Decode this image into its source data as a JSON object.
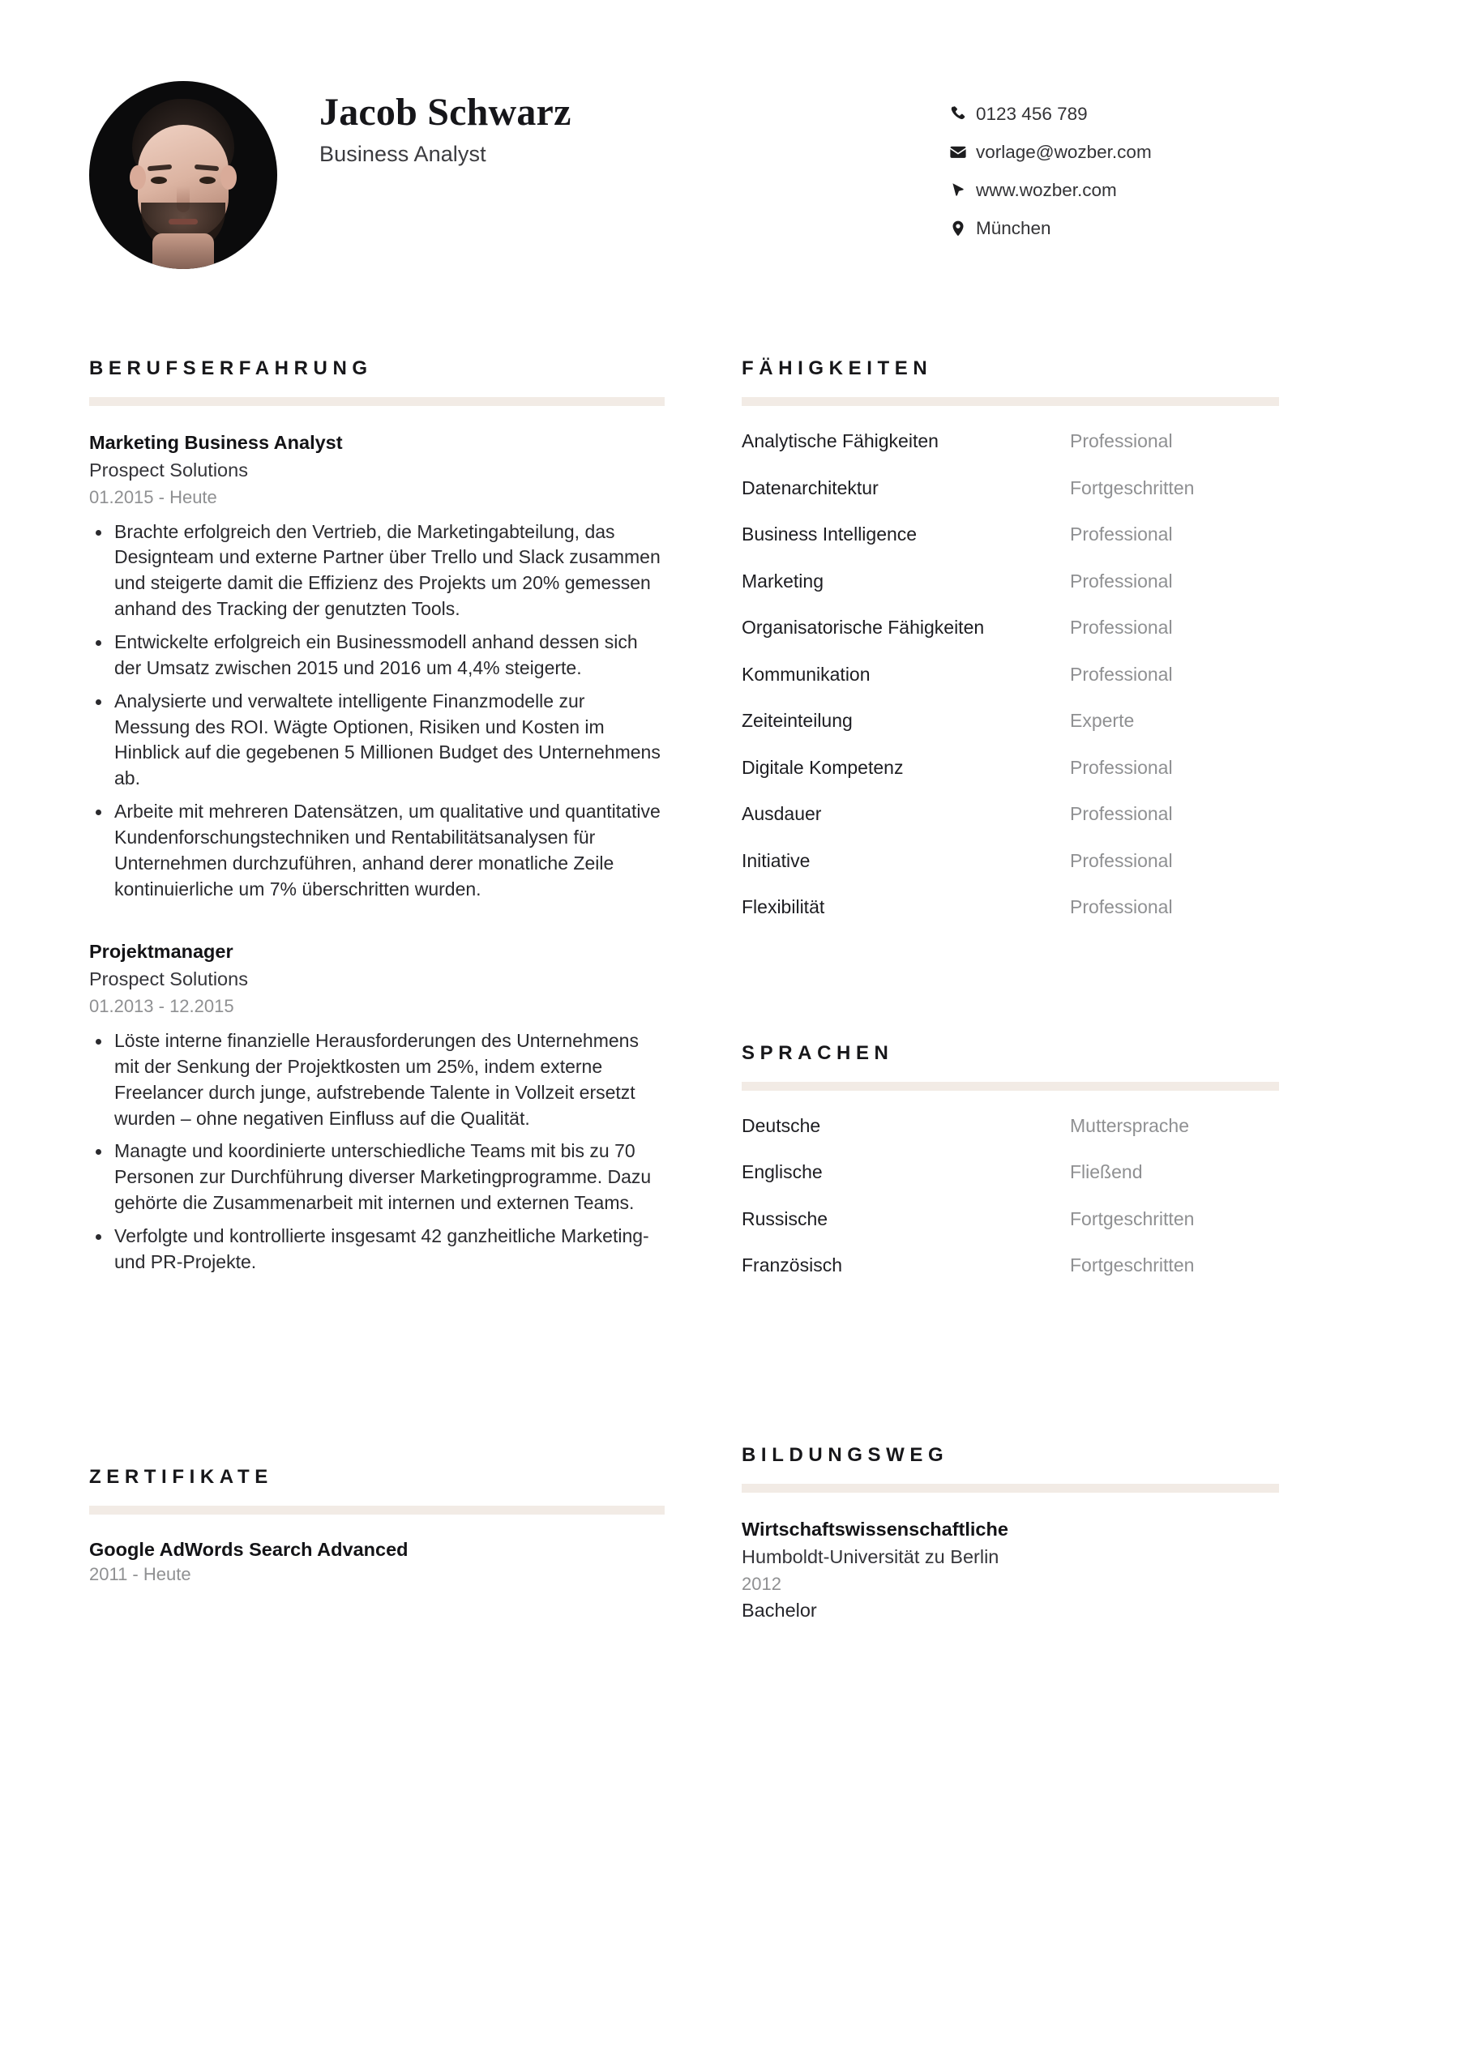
{
  "theme": {
    "accent_rule": "#f2ebe5",
    "text_primary": "#1d1d21",
    "text_muted": "#8f9092",
    "background": "#ffffff"
  },
  "header": {
    "full_name": "Jacob Schwarz",
    "job_title": "Business Analyst",
    "avatar_alt": "portrait-photo",
    "contacts": [
      {
        "icon": "phone-icon",
        "value": "0123 456 789"
      },
      {
        "icon": "envelope-icon",
        "value": "vorlage@wozber.com"
      },
      {
        "icon": "cursor-icon",
        "value": "www.wozber.com"
      },
      {
        "icon": "map-pin-icon",
        "value": "München"
      }
    ]
  },
  "sections": {
    "experience": {
      "title": "BERUFSERFAHRUNG",
      "entries": [
        {
          "role": "Marketing Business Analyst",
          "organization": "Prospect Solutions",
          "dates": "01.2015 - Heute",
          "bullets": [
            "Brachte erfolgreich den Vertrieb, die Marketingabteilung, das Designteam und externe Partner über Trello und Slack zusammen und steigerte damit die Effizienz des Projekts um 20% gemessen anhand des Tracking der genutzten Tools.",
            "Entwickelte erfolgreich ein Businessmodell anhand dessen sich der Umsatz zwischen 2015 und 2016 um 4,4% steigerte.",
            "Analysierte und verwaltete intelligente Finanzmodelle zur Messung des ROI. Wägte Optionen, Risiken und Kosten im Hinblick auf die gegebenen 5 Millionen Budget des Unternehmens ab.",
            "Arbeite mit mehreren Datensätzen, um qualitative und quantitative Kundenforschungstechniken und Rentabilitätsanalysen für Unternehmen durchzuführen, anhand derer monatliche Zeile kontinuierliche um 7% überschritten wurden."
          ]
        },
        {
          "role": "Projektmanager",
          "organization": "Prospect Solutions",
          "dates": "01.2013 - 12.2015",
          "bullets": [
            "Löste interne finanzielle Herausforderungen des Unternehmens mit der Senkung der Projektkosten um 25%, indem externe Freelancer durch junge, aufstrebende Talente in Vollzeit ersetzt wurden – ohne negativen Einfluss auf die Qualität.",
            "Managte und koordinierte unterschiedliche Teams mit bis zu 70 Personen zur Durchführung diverser Marketingprogramme. Dazu gehörte die Zusammenarbeit mit internen und externen Teams.",
            "Verfolgte und kontrollierte insgesamt 42 ganzheitliche Marketing- und PR-Projekte."
          ]
        }
      ]
    },
    "certificates": {
      "title": "ZERTIFIKATE",
      "entries": [
        {
          "name": "Google AdWords Search Advanced",
          "dates": "2011 - Heute"
        }
      ]
    },
    "skills": {
      "title": "FÄHIGKEITEN",
      "items": [
        {
          "name": "Analytische Fähigkeiten",
          "level": "Professional"
        },
        {
          "name": "Datenarchitektur",
          "level": "Fortgeschritten"
        },
        {
          "name": "Business Intelligence",
          "level": "Professional"
        },
        {
          "name": "Marketing",
          "level": "Professional"
        },
        {
          "name": "Organisatorische Fähigkeiten",
          "level": "Professional"
        },
        {
          "name": "Kommunikation",
          "level": "Professional"
        },
        {
          "name": "Zeiteinteilung",
          "level": "Experte"
        },
        {
          "name": "Digitale Kompetenz",
          "level": "Professional"
        },
        {
          "name": "Ausdauer",
          "level": "Professional"
        },
        {
          "name": "Initiative",
          "level": "Professional"
        },
        {
          "name": "Flexibilität",
          "level": "Professional"
        }
      ]
    },
    "languages": {
      "title": "SPRACHEN",
      "items": [
        {
          "name": "Deutsche",
          "level": "Muttersprache"
        },
        {
          "name": "Englische",
          "level": "Fließend"
        },
        {
          "name": "Russische",
          "level": "Fortgeschritten"
        },
        {
          "name": "Französisch",
          "level": "Fortgeschritten"
        }
      ]
    },
    "education": {
      "title": "BILDUNGSWEG",
      "entries": [
        {
          "degree": "Wirtschaftswissenschaftliche",
          "school": "Humboldt-Universität zu Berlin",
          "year": "2012",
          "level": "Bachelor"
        }
      ]
    }
  }
}
